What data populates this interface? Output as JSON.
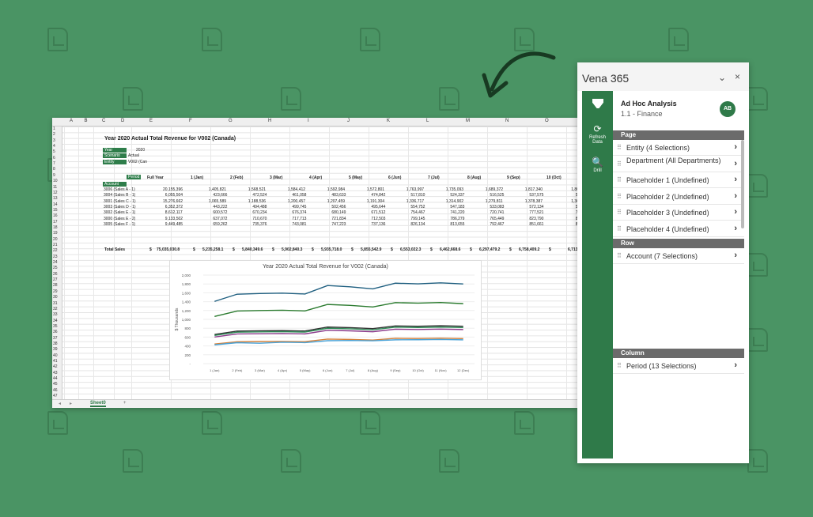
{
  "sheet": {
    "columns": [
      "A",
      "B",
      "C",
      "D",
      "E",
      "F",
      "G",
      "H",
      "I",
      "J",
      "K",
      "L",
      "M",
      "N",
      "O"
    ],
    "title": "Year 2020 Actual Total Revenue for V002 (Canada)",
    "params": [
      {
        "k": "Year",
        "v": "2020"
      },
      {
        "k": "Scenario",
        "v": "Actual"
      },
      {
        "k": "Entity",
        "v": "V002 (Can"
      }
    ],
    "period_label": "Period",
    "account_label": "Account",
    "headers": [
      "Full Year",
      "1 (Jan)",
      "2 (Feb)",
      "3 (Mar)",
      "4 (Apr)",
      "5 (May)",
      "6 (Jun)",
      "7 (Jul)",
      "8 (Aug)",
      "9 (Sep)",
      "10 (Oct)"
    ],
    "rows": [
      {
        "acct": "3006 (Sales A - 1)",
        "vals": [
          "20,155,396",
          "1,405,821",
          "1,568,521",
          "1,584,412",
          "1,592,984",
          "1,572,801",
          "1,763,997",
          "1,735,093",
          "1,689,372",
          "1,817,340",
          "1,802,"
        ]
      },
      {
        "acct": "3004 (Sales B - 1)",
        "vals": [
          "6,055,504",
          "423,666",
          "472,524",
          "461,058",
          "483,633",
          "474,842",
          "517,810",
          "524,337",
          "516,525",
          "537,575",
          "540,"
        ]
      },
      {
        "acct": "3001 (Sales C - 1)",
        "vals": [
          "15,276,662",
          "1,065,589",
          "1,188,536",
          "1,200,457",
          "1,207,459",
          "1,191,304",
          "1,336,717",
          "1,314,902",
          "1,279,811",
          "1,378,387",
          "1,367,"
        ]
      },
      {
        "acct": "3003 (Sales D - 1)",
        "vals": [
          "6,352,372",
          "443,222",
          "494,488",
          "499,745",
          "502,456",
          "495,644",
          "554,752",
          "547,183",
          "533,083",
          "572,134",
          "568,"
        ]
      },
      {
        "acct": "3002 (Sales E - 1)",
        "vals": [
          "8,612,117",
          "600,572",
          "670,234",
          "676,374",
          "680,149",
          "671,512",
          "754,467",
          "741,220",
          "720,741",
          "777,521",
          "771,"
        ]
      },
      {
        "acct": "3000 (Sales E - 2)",
        "vals": [
          "9,133,502",
          "637,072",
          "710,670",
          "717,713",
          "721,834",
          "712,503",
          "799,145",
          "786,279",
          "765,449",
          "823,790",
          "817,"
        ]
      },
      {
        "acct": "3005 (Sales F - 1)",
        "vals": [
          "9,449,485",
          "659,262",
          "735,376",
          "743,081",
          "747,223",
          "737,136",
          "826,134",
          "813,655",
          "792,467",
          "851,661",
          "845,"
        ]
      }
    ],
    "total_label": "Total Sales",
    "totals": [
      "75,035,030.8",
      "5,235,258.1",
      "5,840,349.6",
      "5,902,840.3",
      "5,935,718.0",
      "5,855,542.9",
      "6,553,022.3",
      "6,462,668.6",
      "6,297,479.2",
      "6,758,409.2",
      "6,713,7"
    ],
    "currency": "$",
    "tab": "Sheet0",
    "add_tab": "+"
  },
  "chart_data": {
    "type": "line",
    "title": "Year 2020 Actual Total Revenue for V002 (Canada)",
    "ylabel": "$ Thousands",
    "ylim": [
      0,
      2000
    ],
    "yticks": [
      "2,000",
      "1,800",
      "1,600",
      "1,400",
      "1,200",
      "1,000",
      "800",
      "600",
      "400",
      "200",
      "-"
    ],
    "categories": [
      "1 (Jan)",
      "2 (Feb)",
      "3 (Mar)",
      "4 (Apr)",
      "5 (May)",
      "6 (Jun)",
      "7 (Jul)",
      "8 (Aug)",
      "9 (Sep)",
      "10 (Oct)",
      "11 (Nov)",
      "12 (Dec)"
    ],
    "series": [
      {
        "color": "#1f5f80",
        "values": [
          1406,
          1569,
          1584,
          1593,
          1573,
          1764,
          1735,
          1689,
          1817,
          1802,
          1825,
          1800
        ]
      },
      {
        "color": "#2a7a2e",
        "values": [
          1066,
          1189,
          1200,
          1207,
          1191,
          1337,
          1315,
          1280,
          1378,
          1367,
          1380,
          1355
        ]
      },
      {
        "color": "#333333",
        "values": [
          659,
          735,
          743,
          747,
          737,
          826,
          814,
          792,
          852,
          845,
          855,
          845
        ]
      },
      {
        "color": "#2e8b57",
        "values": [
          637,
          711,
          718,
          722,
          713,
          799,
          786,
          765,
          824,
          817,
          825,
          815
        ]
      },
      {
        "color": "#8b3a8b",
        "values": [
          601,
          670,
          676,
          680,
          672,
          754,
          741,
          721,
          778,
          771,
          780,
          770
        ]
      },
      {
        "color": "#d4803a",
        "values": [
          443,
          494,
          500,
          502,
          496,
          555,
          547,
          533,
          572,
          568,
          575,
          565
        ]
      },
      {
        "color": "#4aa3d8",
        "values": [
          424,
          473,
          461,
          484,
          475,
          518,
          524,
          517,
          538,
          540,
          545,
          538
        ]
      }
    ]
  },
  "panel": {
    "title": "Vena 365",
    "minimize": "⌄",
    "close": "×",
    "rail": [
      {
        "icon": "⟳",
        "label": "Refresh\nData"
      },
      {
        "icon": "🔍",
        "label": "Drill"
      }
    ],
    "analysis": "Ad Hoc Analysis",
    "analysis_sub": "1.1 - Finance",
    "avatar": "AB",
    "page_label": "Page",
    "page_items": [
      "Entity (4 Selections)",
      "Department (All Departments)",
      "Placeholder 1 (Undefined)",
      "Placeholder 2 (Undefined)",
      "Placeholder 3 (Undefined)",
      "Placeholder 4 (Undefined)"
    ],
    "row_label": "Row",
    "row_items": [
      "Account (7 Selections)"
    ],
    "column_label": "Column",
    "column_items": [
      "Period (13 Selections)"
    ]
  }
}
